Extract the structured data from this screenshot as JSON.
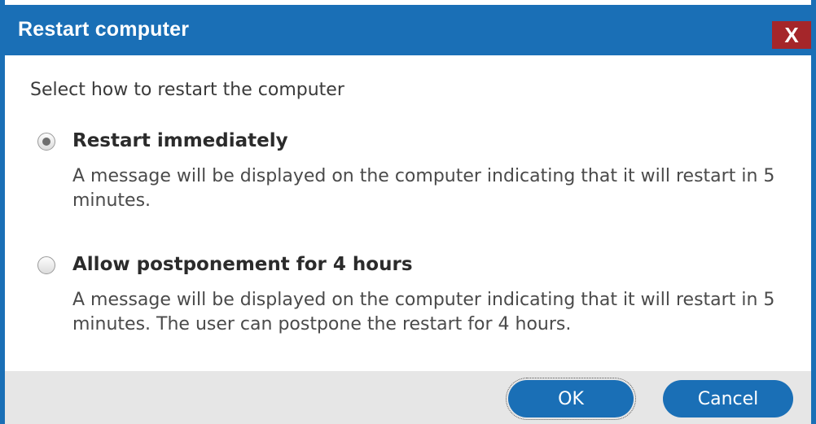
{
  "dialog": {
    "title": "Restart computer",
    "close_label": "X",
    "prompt": "Select how to restart the computer",
    "options": [
      {
        "label": "Restart immediately",
        "description": "A message will be displayed on the computer indicating that it will restart in 5 minutes.",
        "selected": true
      },
      {
        "label": "Allow postponement for 4 hours",
        "description": "A message will be displayed on the computer indicating that it will restart in 5 minutes. The user can postpone the restart for 4 hours.",
        "selected": false
      }
    ],
    "buttons": {
      "ok_label": "OK",
      "cancel_label": "Cancel"
    }
  },
  "colors": {
    "accent": "#1a6fb6",
    "close": "#a5262a",
    "footer": "#e6e6e6"
  }
}
